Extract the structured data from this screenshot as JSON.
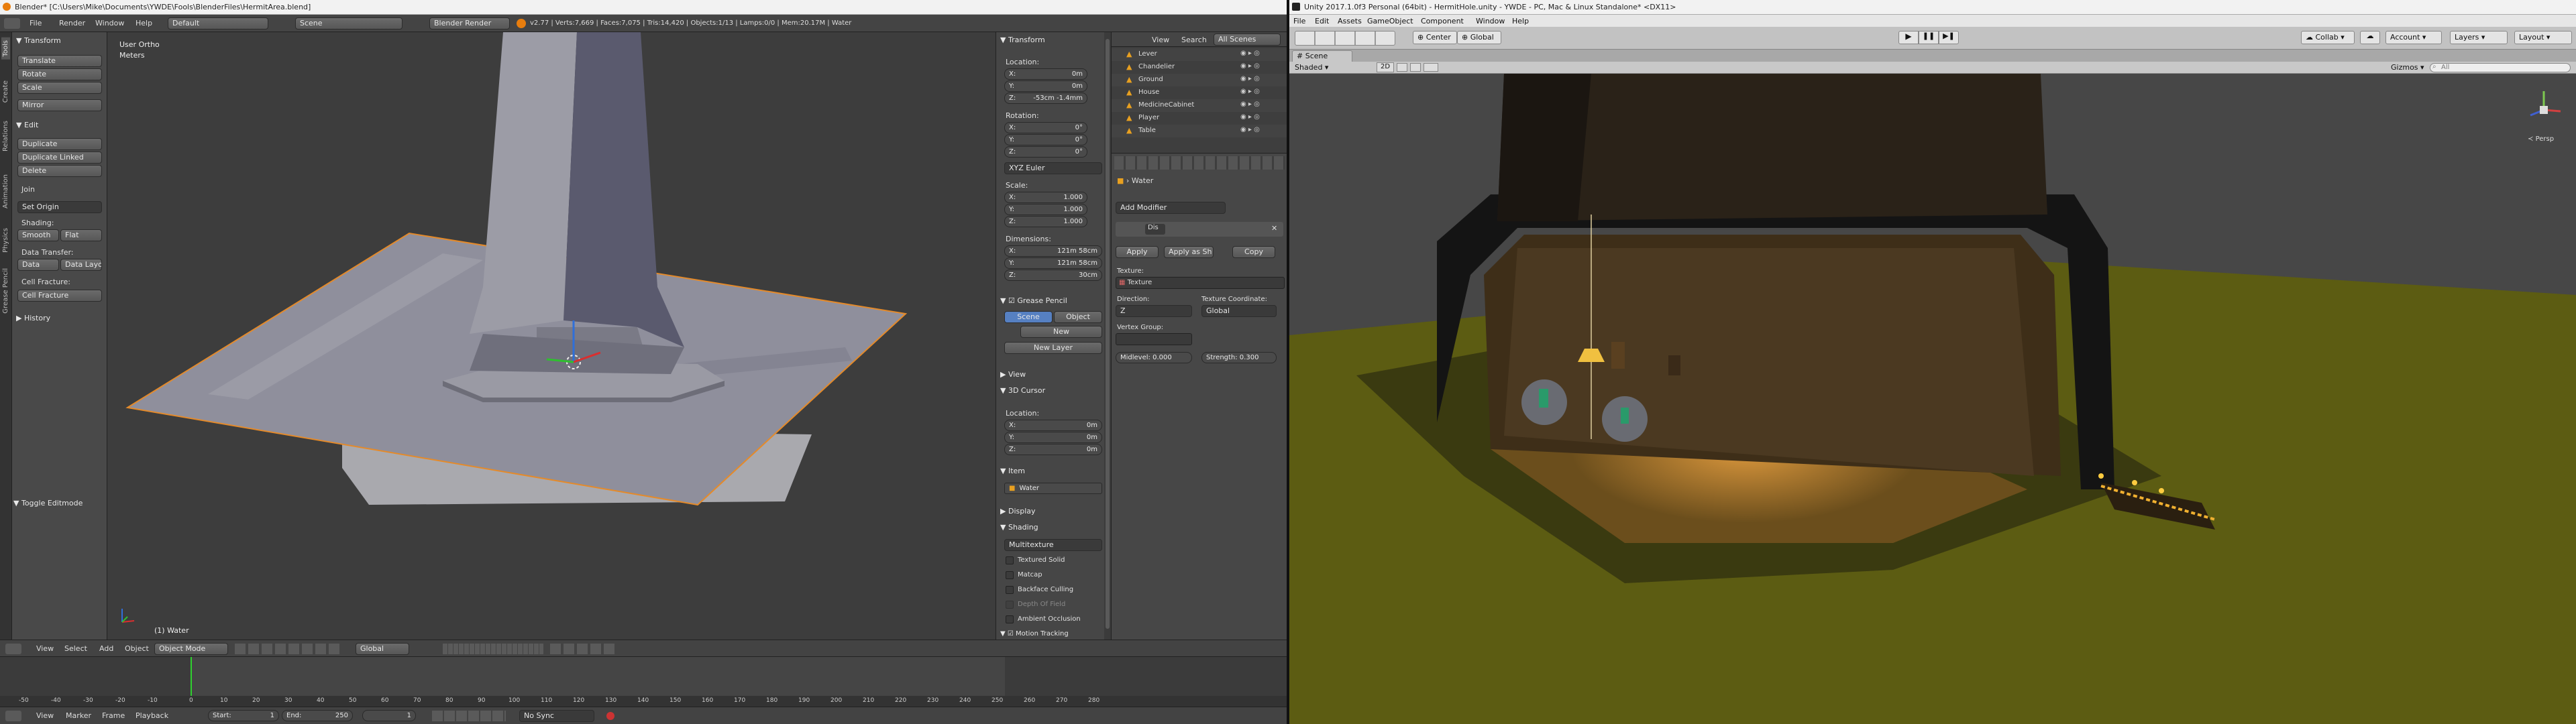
{
  "blender": {
    "title": "Blender* [C:\\Users\\Mike\\Documents\\YWDE\\Fools\\BlenderFiles\\HermitArea.blend]",
    "menus": [
      "File",
      "Render",
      "Window",
      "Help"
    ],
    "layout": "Default",
    "scene": "Scene",
    "engine": "Blender Render",
    "stats": "v2.77 | Verts:7,669 | Faces:7,075 | Tris:14,420 | Objects:1/13 | Lamps:0/0 | Mem:20.17M | Water",
    "tool_tabs": [
      "Tools",
      "Create",
      "Relations",
      "Animation",
      "Physics",
      "Grease Pencil"
    ],
    "toolshelf": {
      "transform_header": "Transform",
      "translate": "Translate",
      "rotate": "Rotate",
      "scale": "Scale",
      "mirror": "Mirror",
      "edit_header": "Edit",
      "duplicate": "Duplicate",
      "duplicate_linked": "Duplicate Linked",
      "delete": "Delete",
      "join": "Join",
      "set_origin": "Set Origin",
      "shading": "Shading:",
      "smooth": "Smooth",
      "flat": "Flat",
      "data_transfer": "Data Transfer:",
      "data": "Data",
      "data_layout": "Data Layo",
      "cell_fracture_label": "Cell Fracture:",
      "cell_fracture": "Cell Fracture",
      "history": "History",
      "toggle_editmode": "Toggle Editmode"
    },
    "viewport": {
      "view_name": "User Ortho",
      "units": "Meters",
      "object_label": "(1) Water"
    },
    "view_header": {
      "view": "View",
      "select": "Select",
      "add": "Add",
      "object": "Object",
      "mode": "Object Mode",
      "orientation": "Global"
    },
    "npanel": {
      "transform": "Transform",
      "location": "Location:",
      "loc": [
        {
          "a": "X:",
          "v": "0m"
        },
        {
          "a": "Y:",
          "v": "0m"
        },
        {
          "a": "Z:",
          "v": "-53cm -1.4mm"
        }
      ],
      "rotation": "Rotation:",
      "rot": [
        {
          "a": "X:",
          "v": "0°"
        },
        {
          "a": "Y:",
          "v": "0°"
        },
        {
          "a": "Z:",
          "v": "0°"
        }
      ],
      "rot_mode": "XYZ Euler",
      "scale": "Scale:",
      "scl": [
        {
          "a": "X:",
          "v": "1.000"
        },
        {
          "a": "Y:",
          "v": "1.000"
        },
        {
          "a": "Z:",
          "v": "1.000"
        }
      ],
      "dimensions": "Dimensions:",
      "dim": [
        {
          "a": "X:",
          "v": "121m 58cm"
        },
        {
          "a": "Y:",
          "v": "121m 58cm"
        },
        {
          "a": "Z:",
          "v": "30cm"
        }
      ],
      "grease_pencil": "Grease Pencil",
      "gp_scene": "Scene",
      "gp_object": "Object",
      "gp_new": "New",
      "gp_new_layer": "New Layer",
      "view": "View",
      "cursor": "3D Cursor",
      "cursor_location": "Location:",
      "cur": [
        {
          "a": "X:",
          "v": "0m"
        },
        {
          "a": "Y:",
          "v": "0m"
        },
        {
          "a": "Z:",
          "v": "0m"
        }
      ],
      "item": "Item",
      "item_name": "Water",
      "display": "Display",
      "shading": "Shading",
      "shading_mode": "Multitexture",
      "opts": [
        "Textured Solid",
        "Matcap",
        "Backface Culling",
        "Depth Of Field",
        "Ambient Occlusion"
      ],
      "motion_tracking": "Motion Tracking"
    },
    "outliner": {
      "view": "View",
      "search": "Search",
      "scenes": "All Scenes",
      "items": [
        "Lever",
        "Chandelier",
        "Ground",
        "House",
        "MedicineCabinet",
        "Player",
        "Table"
      ]
    },
    "properties": {
      "object_name": "Water",
      "add_modifier": "Add Modifier",
      "mod_name": "Dis",
      "apply": "Apply",
      "apply_shape": "Apply as Sh",
      "copy": "Copy",
      "texture_label": "Texture:",
      "texture_name": "Texture",
      "direction_label": "Direction:",
      "direction": "Z",
      "coords_label": "Texture Coordinate:",
      "coords": "Global",
      "vgroup_label": "Vertex Group:",
      "midlevel": "Midlevel: 0.000",
      "strength": "Strength: 0.300"
    },
    "timeline": {
      "ticks": [
        "-50",
        "-40",
        "-30",
        "-20",
        "-10",
        "0",
        "10",
        "20",
        "30",
        "40",
        "50",
        "60",
        "70",
        "80",
        "90",
        "100",
        "110",
        "120",
        "130",
        "140",
        "150",
        "160",
        "170",
        "180",
        "190",
        "200",
        "210",
        "220",
        "230",
        "240",
        "250",
        "260",
        "270",
        "280"
      ],
      "view": "View",
      "marker": "Marker",
      "frame": "Frame",
      "playback": "Playback",
      "start": "Start:",
      "start_v": "1",
      "end": "End:",
      "end_v": "250",
      "current": "1",
      "sync": "No Sync"
    }
  },
  "unity": {
    "title": "Unity 2017.1.0f3 Personal (64bit) - HermitHole.unity - YWDE - PC, Mac & Linux Standalone* <DX11>",
    "menus": [
      "File",
      "Edit",
      "Assets",
      "GameObject",
      "Component",
      "Window",
      "Help"
    ],
    "pivot": "Center",
    "space": "Global",
    "collab": "Collab",
    "account": "Account",
    "layers": "Layers",
    "layout": "Layout",
    "scene_tab": "Scene",
    "shaded": "Shaded",
    "twod": "2D",
    "gizmos": "Gizmos",
    "search": "All",
    "persp": "Persp"
  }
}
